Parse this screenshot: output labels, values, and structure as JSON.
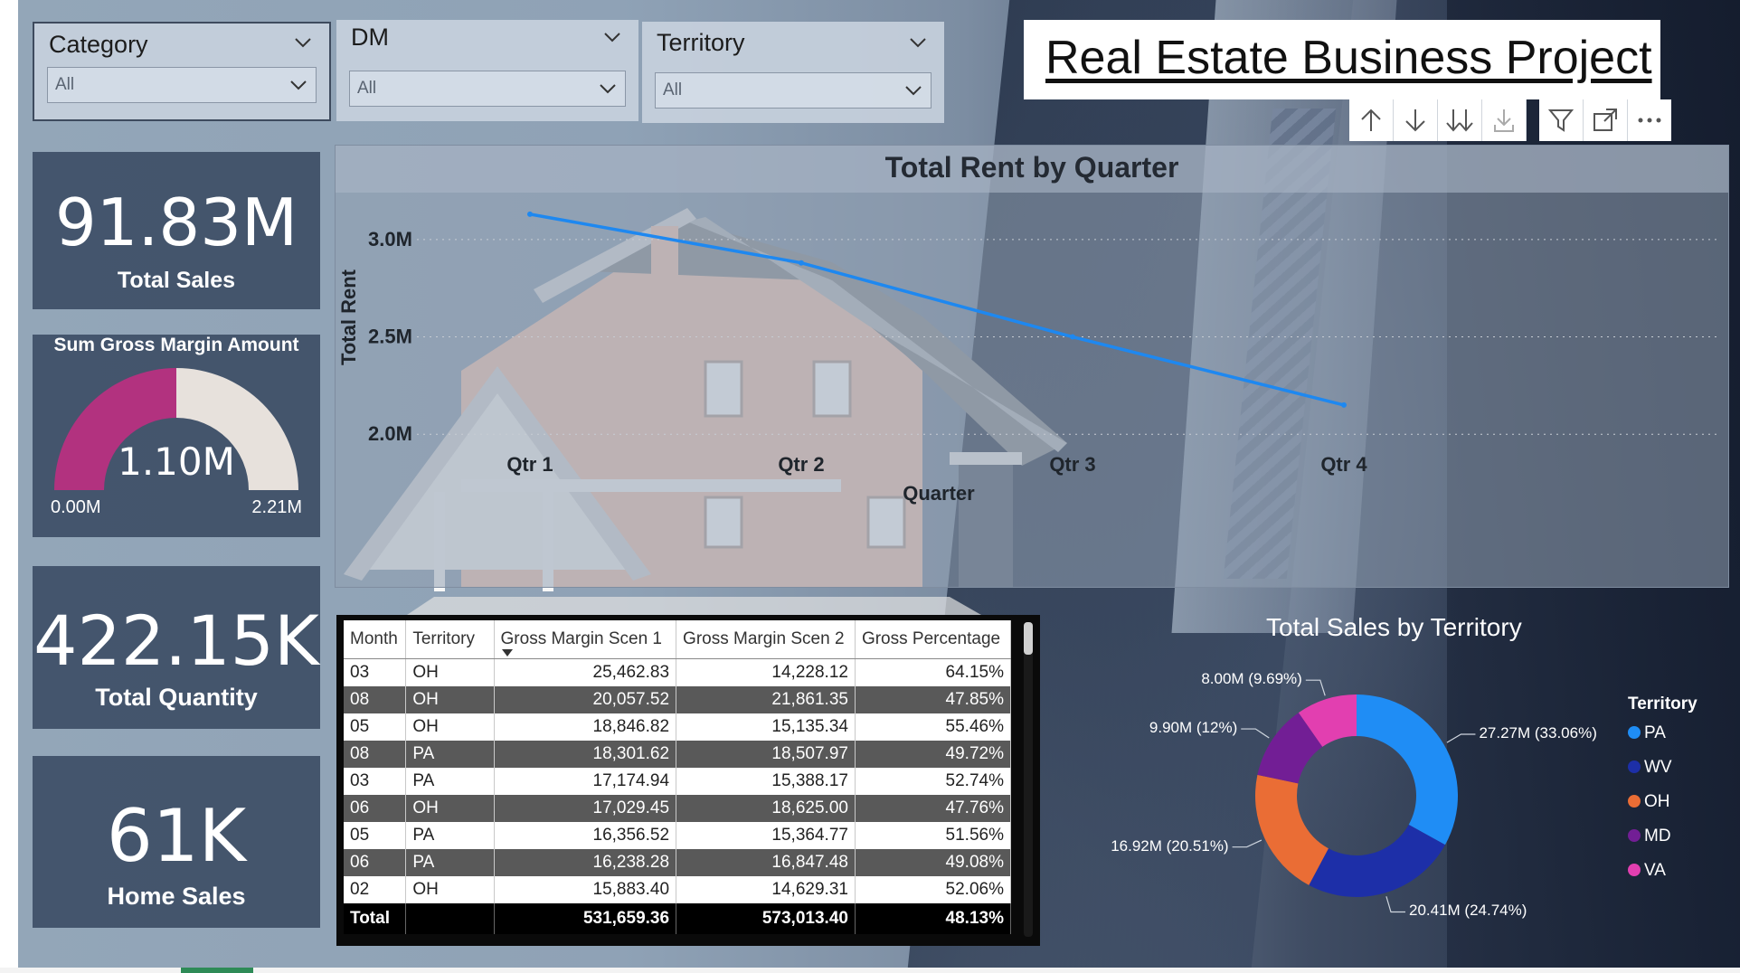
{
  "slicers": [
    {
      "label": "Category",
      "value": "All"
    },
    {
      "label": "DM",
      "value": "All"
    },
    {
      "label": "Territory",
      "value": "All"
    }
  ],
  "report_title": "Real Estate Business Project",
  "toolbar_icons": [
    "arrow-up-icon",
    "arrow-down-icon",
    "double-arrow-down-icon",
    "expand-hierarchy-icon",
    "filter-icon",
    "focus-mode-icon",
    "more-options-icon"
  ],
  "kpis": {
    "total_sales": {
      "value": "91.83M",
      "label": "Total Sales"
    },
    "gauge": {
      "title": "Sum Gross Margin Amount",
      "value": "1.10M",
      "min": "0.00M",
      "max": "2.21M",
      "fraction": 0.5
    },
    "total_quantity": {
      "value": "422.15K",
      "label": "Total Quantity"
    },
    "home_sales": {
      "value": "61K",
      "label": "Home Sales"
    }
  },
  "chart_data": [
    {
      "type": "line",
      "title": "Total Rent by Quarter",
      "xlabel": "Quarter",
      "ylabel": "Total Rent",
      "categories": [
        "Qtr 1",
        "Qtr 2",
        "Qtr 3",
        "Qtr 4"
      ],
      "values": [
        3.13,
        2.88,
        2.5,
        2.15
      ],
      "unit": "M",
      "yticks": [
        "2.0M",
        "2.5M",
        "3.0M"
      ],
      "ylim": [
        1.95,
        3.25
      ],
      "color": "#1e88f0"
    },
    {
      "type": "pie",
      "title": "Total Sales by Territory",
      "legend_title": "Territory",
      "legend_position": "right",
      "slices": [
        {
          "name": "PA",
          "value": 27.27,
          "label": "27.27M (33.06%)",
          "color": "#1f8df5"
        },
        {
          "name": "WV",
          "value": 20.41,
          "label": "20.41M (24.74%)",
          "color": "#1d2fa8"
        },
        {
          "name": "OH",
          "value": 16.92,
          "label": "16.92M (20.51%)",
          "color": "#ea6d35"
        },
        {
          "name": "MD",
          "value": 9.9,
          "label": "9.90M (12%)",
          "color": "#721e95"
        },
        {
          "name": "VA",
          "value": 8.0,
          "label": "8.00M (9.69%)",
          "color": "#e23fb0"
        }
      ]
    }
  ],
  "table": {
    "columns": [
      "Month",
      "Territory",
      "Gross Margin Scen 1",
      "Gross Margin Scen 2",
      "Gross Percentage"
    ],
    "rows": [
      [
        "03",
        "OH",
        "25,462.83",
        "14,228.12",
        "64.15%"
      ],
      [
        "08",
        "OH",
        "20,057.52",
        "21,861.35",
        "47.85%"
      ],
      [
        "05",
        "OH",
        "18,846.82",
        "15,135.34",
        "55.46%"
      ],
      [
        "08",
        "PA",
        "18,301.62",
        "18,507.97",
        "49.72%"
      ],
      [
        "03",
        "PA",
        "17,174.94",
        "15,388.17",
        "52.74%"
      ],
      [
        "06",
        "OH",
        "17,029.45",
        "18,625.00",
        "47.76%"
      ],
      [
        "05",
        "PA",
        "16,356.52",
        "15,364.77",
        "51.56%"
      ],
      [
        "06",
        "PA",
        "16,238.28",
        "16,847.48",
        "49.08%"
      ],
      [
        "02",
        "OH",
        "15,883.40",
        "14,629.31",
        "52.06%"
      ]
    ],
    "total": [
      "Total",
      "",
      "531,659.36",
      "573,013.40",
      "48.13%"
    ]
  }
}
